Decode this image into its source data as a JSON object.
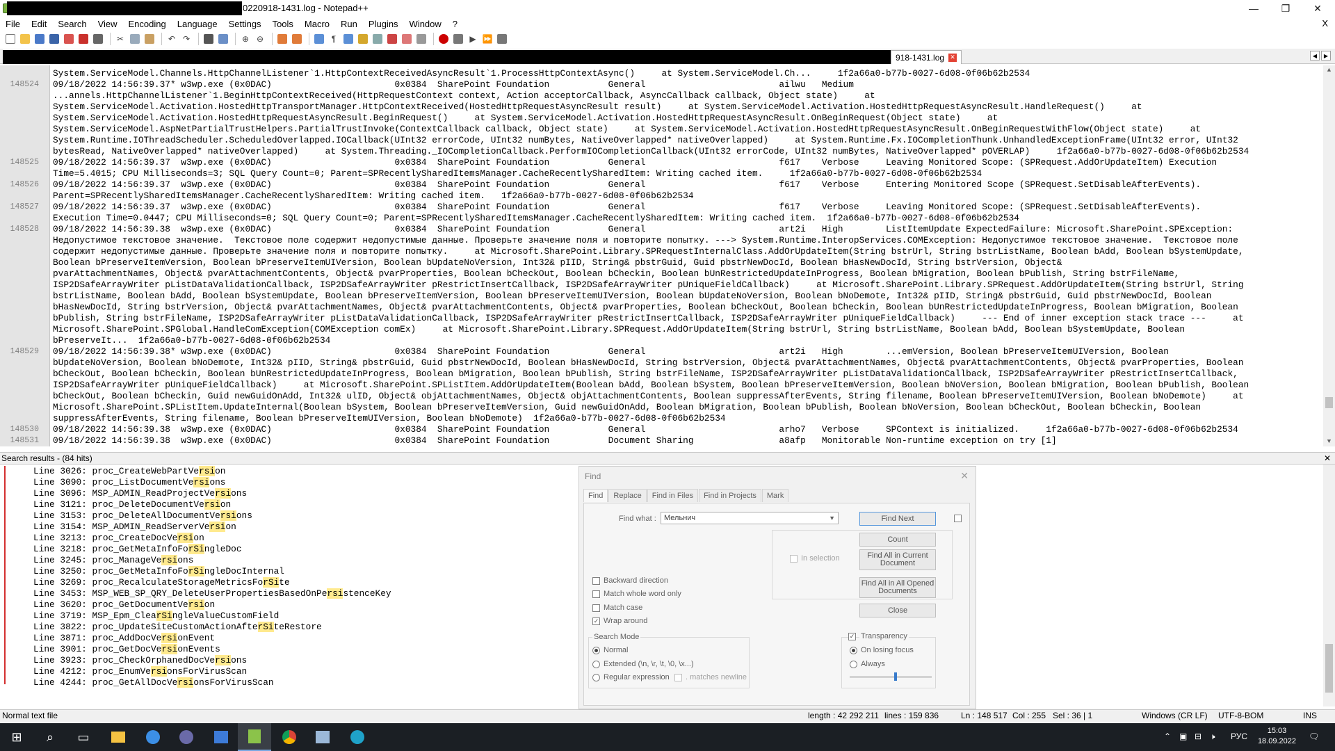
{
  "window": {
    "title": "0220918-1431.log - Notepad++",
    "controls": {
      "minimize": "—",
      "maximize": "❐",
      "close": "✕"
    }
  },
  "menu": {
    "items": [
      "File",
      "Edit",
      "Search",
      "View",
      "Encoding",
      "Language",
      "Settings",
      "Tools",
      "Macro",
      "Run",
      "Plugins",
      "Window",
      "?"
    ],
    "close_doc": "X"
  },
  "tab": {
    "label": "918-1431.log"
  },
  "editor": {
    "lines": [
      {
        "num": "",
        "text": "System.ServiceModel.Channels.HttpChannelListener`1.HttpContextReceivedAsyncResult`1.ProcessHttpContextAsync()     at System.ServiceModel.Ch...     1f2a66a0-b77b-0027-6d08-0f06b62b2534"
      },
      {
        "num": "148524",
        "text": "09/18/2022 14:56:39.37* w3wp.exe (0x0DAC)                       0x0384  SharePoint Foundation           General                         ailwu   Medium"
      },
      {
        "num": "",
        "text": "...annels.HttpChannelListener`1.BeginHttpContextReceived(HttpRequestContext context, Action acceptorCallback, AsyncCallback callback, Object state)     at"
      },
      {
        "num": "",
        "text": "System.ServiceModel.Activation.HostedHttpTransportManager.HttpContextReceived(HostedHttpRequestAsyncResult result)     at System.ServiceModel.Activation.HostedHttpRequestAsyncResult.HandleRequest()     at"
      },
      {
        "num": "",
        "text": "System.ServiceModel.Activation.HostedHttpRequestAsyncResult.BeginRequest()     at System.ServiceModel.Activation.HostedHttpRequestAsyncResult.OnBeginRequest(Object state)     at"
      },
      {
        "num": "",
        "text": "System.ServiceModel.AspNetPartialTrustHelpers.PartialTrustInvoke(ContextCallback callback, Object state)     at System.ServiceModel.Activation.HostedHttpRequestAsyncResult.OnBeginRequestWithFlow(Object state)     at"
      },
      {
        "num": "",
        "text": "System.Runtime.IOThreadScheduler.ScheduledOverlapped.IOCallback(UInt32 errorCode, UInt32 numBytes, NativeOverlapped* nativeOverlapped)     at System.Runtime.Fx.IOCompletionThunk.UnhandledExceptionFrame(UInt32 error, UInt32"
      },
      {
        "num": "",
        "text": "bytesRead, NativeOverlapped* nativeOverlapped)     at System.Threading._IOCompletionCallback.PerformIOCompletionCallback(UInt32 errorCode, UInt32 numBytes, NativeOverlapped* pOVERLAP)     1f2a66a0-b77b-0027-6d08-0f06b62b2534"
      },
      {
        "num": "148525",
        "text": "09/18/2022 14:56:39.37  w3wp.exe (0x0DAC)                       0x0384  SharePoint Foundation           General                         f617    Verbose     Leaving Monitored Scope: (SPRequest.AddOrUpdateItem) Execution"
      },
      {
        "num": "",
        "text": "Time=5.4015; CPU Milliseconds=3; SQL Query Count=0; Parent=SPRecentlySharedItemsManager.CacheRecentlySharedItem: Writing cached item.     1f2a66a0-b77b-0027-6d08-0f06b62b2534"
      },
      {
        "num": "148526",
        "text": "09/18/2022 14:56:39.37  w3wp.exe (0x0DAC)                       0x0384  SharePoint Foundation           General                         f617    Verbose     Entering Monitored Scope (SPRequest.SetDisableAfterEvents)."
      },
      {
        "num": "",
        "text": "Parent=SPRecentlySharedItemsManager.CacheRecentlySharedItem: Writing cached item.   1f2a66a0-b77b-0027-6d08-0f06b62b2534"
      },
      {
        "num": "148527",
        "text": "09/18/2022 14:56:39.37  w3wp.exe (0x0DAC)                       0x0384  SharePoint Foundation           General                         f617    Verbose     Leaving Monitored Scope: (SPRequest.SetDisableAfterEvents)."
      },
      {
        "num": "",
        "text": "Execution Time=0.0447; CPU Milliseconds=0; SQL Query Count=0; Parent=SPRecentlySharedItemsManager.CacheRecentlySharedItem: Writing cached item.  1f2a66a0-b77b-0027-6d08-0f06b62b2534"
      },
      {
        "num": "148528",
        "text": "09/18/2022 14:56:39.38  w3wp.exe (0x0DAC)                       0x0384  SharePoint Foundation           General                         art2i   High        ListItemUpdate ExpectedFailure: Microsoft.SharePoint.SPException:"
      },
      {
        "num": "",
        "text": "Недопустимое текстовое значение.  Текстовое поле содержит недопустимые данные. Проверьте значение поля и повторите попытку. ---> System.Runtime.InteropServices.COMException: Недопустимое текстовое значение.  Текстовое поле"
      },
      {
        "num": "",
        "text": "содержит недопустимые данные. Проверьте значение поля и повторите попытку.     at Microsoft.SharePoint.Library.SPRequestInternalClass.AddOrUpdateItem(String bstrUrl, String bstrListName, Boolean bAdd, Boolean bSystemUpdate,"
      },
      {
        "num": "",
        "text": "Boolean bPreserveItemVersion, Boolean bPreserveItemUIVersion, Boolean bUpdateNoVersion, Int32& pIID, String& pbstrGuid, Guid pbstrNewDocId, Boolean bHasNewDocId, String bstrVersion, Object&"
      },
      {
        "num": "",
        "text": "pvarAttachmentNames, Object& pvarAttachmentContents, Object& pvarProperties, Boolean bCheckOut, Boolean bCheckin, Boolean bUnRestrictedUpdateInProgress, Boolean bMigration, Boolean bPublish, String bstrFileName,"
      },
      {
        "num": "",
        "text": "ISP2DSafeArrayWriter pListDataValidationCallback, ISP2DSafeArrayWriter pRestrictInsertCallback, ISP2DSafeArrayWriter pUniqueFieldCallback)     at Microsoft.SharePoint.Library.SPRequest.AddOrUpdateItem(String bstrUrl, String"
      },
      {
        "num": "",
        "text": "bstrListName, Boolean bAdd, Boolean bSystemUpdate, Boolean bPreserveItemVersion, Boolean bPreserveItemUIVersion, Boolean bUpdateNoVersion, Boolean bNoDemote, Int32& pIID, String& pbstrGuid, Guid pbstrNewDocId, Boolean"
      },
      {
        "num": "",
        "text": "bHasNewDocId, String bstrVersion, Object& pvarAttachmentNames, Object& pvarAttachmentContents, Object& pvarProperties, Boolean bCheckOut, Boolean bCheckin, Boolean bUnRestrictedUpdateInProgress, Boolean bMigration, Boolean"
      },
      {
        "num": "",
        "text": "bPublish, String bstrFileName, ISP2DSafeArrayWriter pListDataValidationCallback, ISP2DSafeArrayWriter pRestrictInsertCallback, ISP2DSafeArrayWriter pUniqueFieldCallback)     --- End of inner exception stack trace ---     at"
      },
      {
        "num": "",
        "text": "Microsoft.SharePoint.SPGlobal.HandleComException(COMException comEx)     at Microsoft.SharePoint.Library.SPRequest.AddOrUpdateItem(String bstrUrl, String bstrListName, Boolean bAdd, Boolean bSystemUpdate, Boolean"
      },
      {
        "num": "",
        "text": "bPreserveIt...  1f2a66a0-b77b-0027-6d08-0f06b62b2534"
      },
      {
        "num": "148529",
        "text": "09/18/2022 14:56:39.38* w3wp.exe (0x0DAC)                       0x0384  SharePoint Foundation           General                         art2i   High        ...emVersion, Boolean bPreserveItemUIVersion, Boolean"
      },
      {
        "num": "",
        "text": "bUpdateNoVersion, Boolean bNoDemote, Int32& pIID, String& pbstrGuid, Guid pbstrNewDocId, Boolean bHasNewDocId, String bstrVersion, Object& pvarAttachmentNames, Object& pvarAttachmentContents, Object& pvarProperties, Boolean"
      },
      {
        "num": "",
        "text": "bCheckOut, Boolean bCheckin, Boolean bUnRestrictedUpdateInProgress, Boolean bMigration, Boolean bPublish, String bstrFileName, ISP2DSafeArrayWriter pListDataValidationCallback, ISP2DSafeArrayWriter pRestrictInsertCallback,"
      },
      {
        "num": "",
        "text": "ISP2DSafeArrayWriter pUniqueFieldCallback)     at Microsoft.SharePoint.SPListItem.AddOrUpdateItem(Boolean bAdd, Boolean bSystem, Boolean bPreserveItemVersion, Boolean bNoVersion, Boolean bMigration, Boolean bPublish, Boolean"
      },
      {
        "num": "",
        "text": "bCheckOut, Boolean bCheckin, Guid newGuidOnAdd, Int32& ulID, Object& objAttachmentNames, Object& objAttachmentContents, Boolean suppressAfterEvents, String filename, Boolean bPreserveItemUIVersion, Boolean bNoDemote)     at"
      },
      {
        "num": "",
        "text": "Microsoft.SharePoint.SPListItem.UpdateInternal(Boolean bSystem, Boolean bPreserveItemVersion, Guid newGuidOnAdd, Boolean bMigration, Boolean bPublish, Boolean bNoVersion, Boolean bCheckOut, Boolean bCheckin, Boolean"
      },
      {
        "num": "",
        "text": "suppressAfterEvents, String filename, Boolean bPreserveItemUIVersion, Boolean bNoDemote)  1f2a66a0-b77b-0027-6d08-0f06b62b2534"
      },
      {
        "num": "148530",
        "text": "09/18/2022 14:56:39.38  w3wp.exe (0x0DAC)                       0x0384  SharePoint Foundation           General                         arho7   Verbose     SPContext is initialized.     1f2a66a0-b77b-0027-6d08-0f06b62b2534"
      },
      {
        "num": "148531",
        "text": "09/18/2022 14:56:39.38  w3wp.exe (0x0DAC)                       0x0384  SharePoint Foundation           Document Sharing                a8afp   Monitorable Non-runtime exception on try [1]"
      }
    ]
  },
  "search_results": {
    "header": "Search results - (84 hits)",
    "rows": [
      {
        "line": "3026",
        "segs": [
          "proc_CreateWebPartVe",
          "rsi",
          "on"
        ]
      },
      {
        "line": "3090",
        "segs": [
          "proc_ListDocumentVe",
          "rsi",
          "ons"
        ]
      },
      {
        "line": "3096",
        "segs": [
          "MSP_ADMIN_ReadProjectVe",
          "rsi",
          "ons"
        ]
      },
      {
        "line": "3121",
        "segs": [
          "proc_DeleteDocumentVe",
          "rsi",
          "on"
        ]
      },
      {
        "line": "3153",
        "segs": [
          "proc_DeleteAllDocumentVe",
          "rsi",
          "ons"
        ]
      },
      {
        "line": "3154",
        "segs": [
          "MSP_ADMIN_ReadServerVe",
          "rsi",
          "on"
        ]
      },
      {
        "line": "3213",
        "segs": [
          "proc_CreateDocVe",
          "rsi",
          "on"
        ]
      },
      {
        "line": "3218",
        "segs": [
          "proc_GetMetaInfoFo",
          "rSi",
          "ngleDoc"
        ]
      },
      {
        "line": "3245",
        "segs": [
          "proc_ManageVe",
          "rsi",
          "ons"
        ]
      },
      {
        "line": "3250",
        "segs": [
          "proc_GetMetaInfoFo",
          "rSi",
          "ngleDocInternal"
        ]
      },
      {
        "line": "3269",
        "segs": [
          "proc_RecalculateStorageMetricsFo",
          "rSi",
          "te"
        ]
      },
      {
        "line": "3453",
        "segs": [
          "MSP_WEB_SP_QRY_DeleteUserPropertiesBasedOnPe",
          "rsi",
          "stenceKey"
        ]
      },
      {
        "line": "3620",
        "segs": [
          "proc_GetDocumentVe",
          "rsi",
          "on"
        ]
      },
      {
        "line": "3719",
        "segs": [
          "MSP_Epm_Clea",
          "rSi",
          "ngleValueCustomField"
        ]
      },
      {
        "line": "3822",
        "segs": [
          "proc_UpdateSiteCustomActionAfte",
          "rSi",
          "teRestore"
        ]
      },
      {
        "line": "3871",
        "segs": [
          "proc_AddDocVe",
          "rsi",
          "onEvent"
        ]
      },
      {
        "line": "3901",
        "segs": [
          "proc_GetDocVe",
          "rsi",
          "onEvents"
        ]
      },
      {
        "line": "3923",
        "segs": [
          "proc_CheckOrphanedDocVe",
          "rsi",
          "ons"
        ]
      },
      {
        "line": "4212",
        "segs": [
          "proc_EnumVe",
          "rsi",
          "onsForVirusScan"
        ]
      },
      {
        "line": "4244",
        "segs": [
          "proc_GetAllDocVe",
          "rsi",
          "onsForVirusScan"
        ]
      }
    ]
  },
  "find_dialog": {
    "title": "Find",
    "tabs": [
      "Find",
      "Replace",
      "Find in Files",
      "Find in Projects",
      "Mark"
    ],
    "find_what_label": "Find what :",
    "find_what_value": "Мельнич",
    "buttons": {
      "find_next": "Find Next",
      "count": "Count",
      "find_all_current": "Find All in Current Document",
      "find_all_opened": "Find All in All Opened Documents",
      "close": "Close"
    },
    "in_selection": "In selection",
    "options": {
      "backward": "Backward direction",
      "whole_word": "Match whole word only",
      "match_case": "Match case",
      "wrap_around": "Wrap around"
    },
    "search_mode": {
      "label": "Search Mode",
      "normal": "Normal",
      "extended": "Extended (\\n, \\r, \\t, \\0, \\x...)",
      "regex": "Regular expression",
      "matches_newline": ". matches newline"
    },
    "transparency": {
      "label": "Transparency",
      "on_losing_focus": "On losing focus",
      "always": "Always"
    }
  },
  "status": {
    "file_type": "Normal text file",
    "length": "length : 42 292 211",
    "lines": "lines : 159 836",
    "ln": "Ln : 148 517",
    "col": "Col : 255",
    "sel": "Sel : 36 | 1",
    "eol": "Windows (CR LF)",
    "encoding": "UTF-8-BOM",
    "mode": "INS"
  },
  "taskbar": {
    "lang": "РУС",
    "time": "15:03",
    "date": "18.09.2022"
  }
}
